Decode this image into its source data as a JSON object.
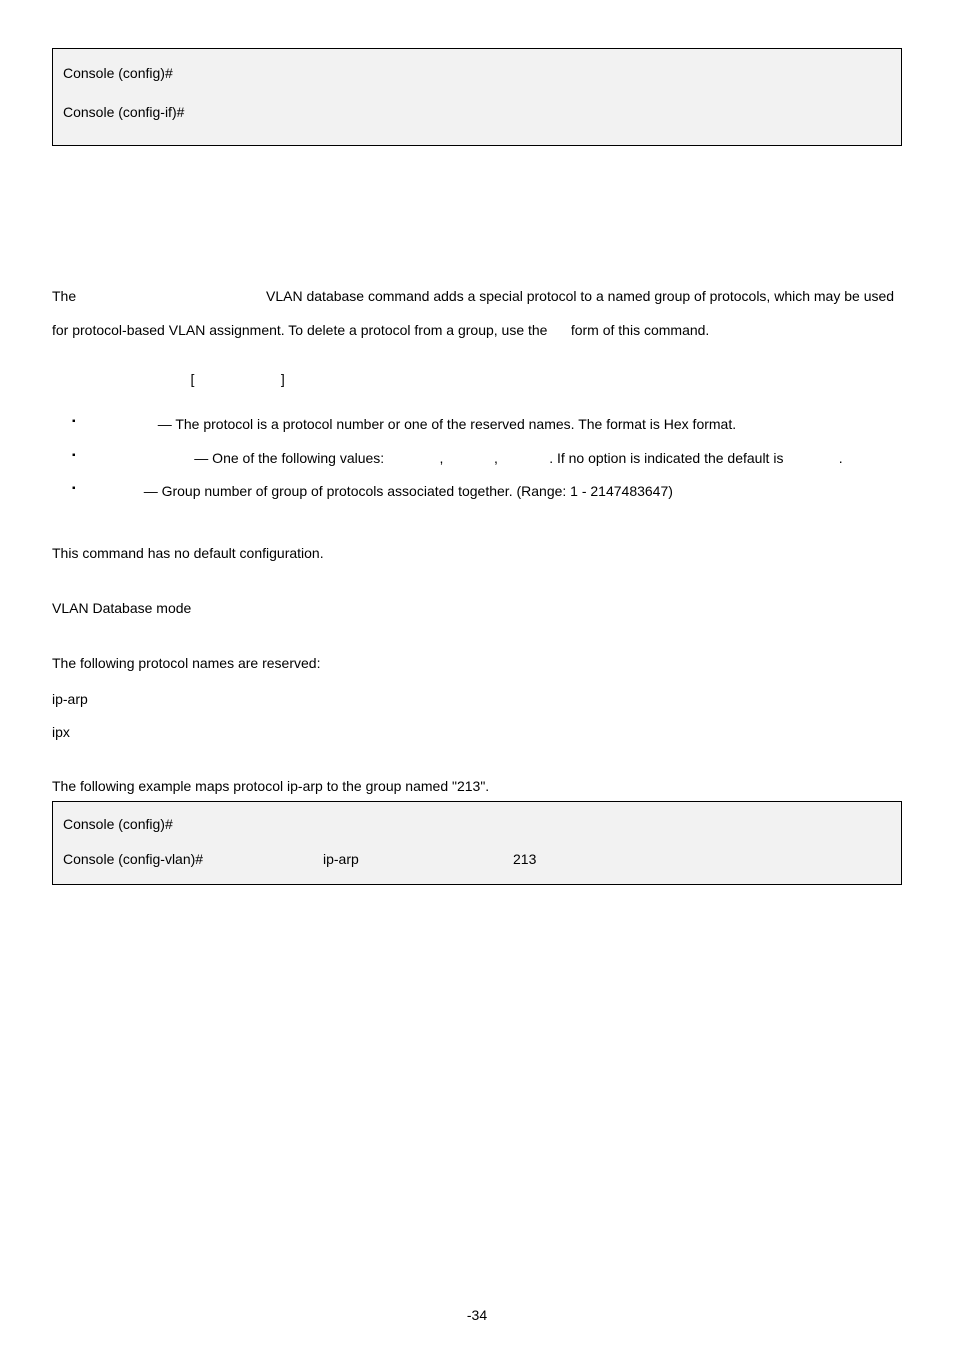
{
  "top_code": {
    "line1": "Console (config)#",
    "line2": "Console (config-if)#"
  },
  "intro": {
    "pre": "The ",
    "mid": " VLAN database command adds a special protocol to a named group of protocols, which may be used for protocol-based VLAN assignment. To delete a protocol from a group, use the ",
    "post": " form of this command."
  },
  "syntax_open": "[",
  "syntax_close": "]",
  "params": {
    "p1": " — The protocol is a protocol number or one of the reserved names. The format is Hex format.",
    "p2a": " — One of the following values: ",
    "p2b": ", ",
    "p2c": ", ",
    "p2d": ". If no option is indicated the default is ",
    "p2e": ".",
    "p3": " — Group number of group of protocols associated together. (Range: 1 - 2147483647)"
  },
  "default_cfg": "This command has no default configuration.",
  "cmd_mode": "VLAN Database mode",
  "guidelines": {
    "intro": "The following protocol names are reserved:",
    "r1": "ip-arp",
    "r2": "ipx"
  },
  "example_desc": "The following example maps protocol ip-arp to the group named \"213\".",
  "example_code": {
    "r1c1": "Console (config)#",
    "r2c1": "Console (config-vlan)#",
    "r2c2": "ip-arp",
    "r2c3": "213"
  },
  "page_number": "-34"
}
